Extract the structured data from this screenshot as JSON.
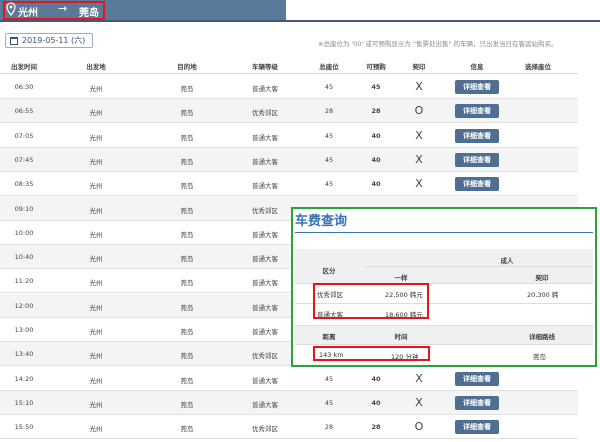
{
  "route": {
    "from": "光州",
    "to": "莞岛",
    "arrow": "→"
  },
  "date": {
    "label": "2019-05-11 (六)"
  },
  "notice": "※总座位为 '00' 或可预购显示为 \"售票处出售\" 的车辆，只出发当日在客运站购买。",
  "table": {
    "headers": [
      "出发时间",
      "出发地",
      "目的地",
      "车辆等级",
      "总座位",
      "可预购",
      "契印",
      "信息",
      "选择座位"
    ],
    "rows": [
      [
        "06:30",
        "光州",
        "莞岛",
        "普通大客",
        "45",
        "45",
        "X",
        "详细查看"
      ],
      [
        "06:55",
        "光州",
        "莞岛",
        "优秀郊区",
        "28",
        "28",
        "O",
        "详细查看"
      ],
      [
        "07:05",
        "光州",
        "莞岛",
        "普通大客",
        "45",
        "40",
        "X",
        "详细查看"
      ],
      [
        "07:45",
        "光州",
        "莞岛",
        "普通大客",
        "45",
        "40",
        "X",
        "详细查看"
      ],
      [
        "08:35",
        "光州",
        "莞岛",
        "普通大客",
        "45",
        "40",
        "X",
        "详细查看"
      ],
      [
        "09:10",
        "光州",
        "莞岛",
        "优秀郊区",
        "",
        "",
        "",
        ""
      ],
      [
        "10:00",
        "光州",
        "莞岛",
        "普通大客",
        "",
        "",
        "",
        ""
      ],
      [
        "10:40",
        "光州",
        "莞岛",
        "普通大客",
        "",
        "",
        "",
        ""
      ],
      [
        "11:20",
        "光州",
        "莞岛",
        "普通大客",
        "",
        "",
        "",
        ""
      ],
      [
        "12:00",
        "光州",
        "莞岛",
        "普通大客",
        "",
        "",
        "",
        ""
      ],
      [
        "13:00",
        "光州",
        "莞岛",
        "普通大客",
        "",
        "",
        "",
        ""
      ],
      [
        "13:40",
        "光州",
        "莞岛",
        "优秀郊区",
        "",
        "",
        "",
        ""
      ],
      [
        "14:20",
        "光州",
        "莞岛",
        "普通大客",
        "45",
        "40",
        "X",
        "详细查看"
      ],
      [
        "15:10",
        "光州",
        "莞岛",
        "普通大客",
        "45",
        "40",
        "X",
        "详细查看"
      ],
      [
        "15:50",
        "光州",
        "莞岛",
        "优秀郊区",
        "28",
        "28",
        "O",
        "详细查看"
      ]
    ]
  },
  "popup": {
    "title": "车费查询",
    "col_category": "区分",
    "col_adult": "成人",
    "col_general": "一样",
    "col_contract": "契印",
    "fares": [
      {
        "type": "优秀郊区",
        "general": "22,500 韩元",
        "contract": "20,300 韩"
      },
      {
        "type": "普通大客",
        "general": "18,600 韩元",
        "contract": ""
      }
    ],
    "col_distance": "距离",
    "col_time": "时间",
    "col_route": "详细路线",
    "distance": "143 km",
    "duration": "120 分钟",
    "route_detail": "莞岛"
  }
}
